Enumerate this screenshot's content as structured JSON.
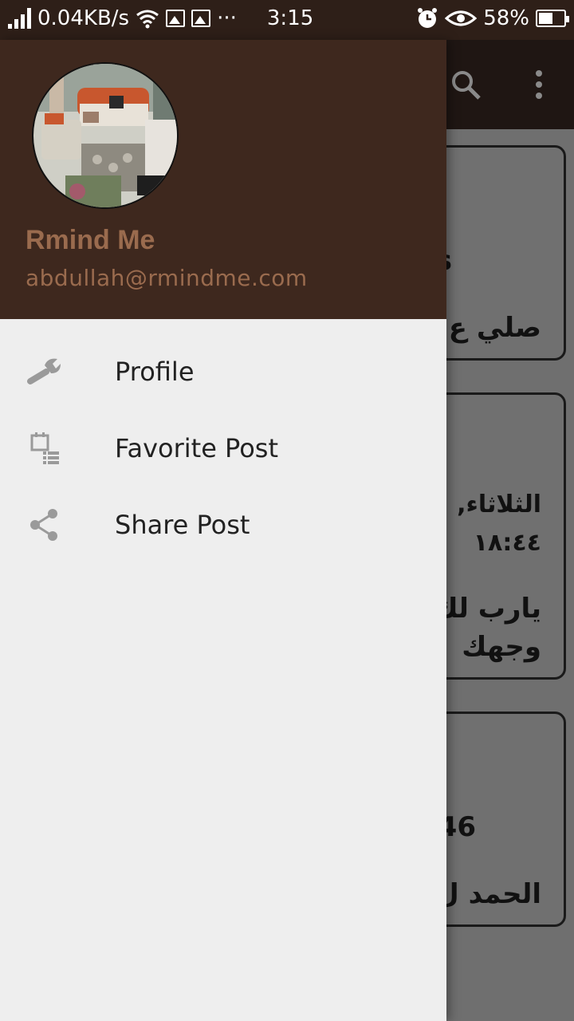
{
  "status_bar": {
    "speed": "0.04KB/s",
    "time": "3:15",
    "battery": "58%",
    "battery_level": 0.58,
    "icons": [
      "signal-icon",
      "wifi-icon",
      "image-icon",
      "image-icon",
      "more-notifications-icon",
      "alarm-icon",
      "eye-icon",
      "battery-icon"
    ]
  },
  "toolbar": {
    "icons": [
      "search-icon",
      "more-vert-icon"
    ]
  },
  "background_cards": [
    {
      "lines": [
        "s",
        "صلي ع"
      ]
    },
    {
      "lines": [
        "الثلاثاء,",
        "١٨:٤٤",
        "يارب لك",
        "وجهك"
      ]
    },
    {
      "lines": [
        "46",
        "الحمد ل"
      ]
    }
  ],
  "drawer": {
    "user": {
      "name": "Rmind Me",
      "email": "abdullah@rmindme.com"
    },
    "menu": [
      {
        "label": "Profile",
        "icon": "wrench-icon"
      },
      {
        "label": "Favorite Post",
        "icon": "calendar-list-icon"
      },
      {
        "label": "Share Post",
        "icon": "share-icon"
      }
    ]
  },
  "colors": {
    "status_bar": "#2e1f18",
    "drawer_header": "#3e281e",
    "user_text": "#9a6b4e",
    "drawer_bg": "#eeeeee"
  }
}
